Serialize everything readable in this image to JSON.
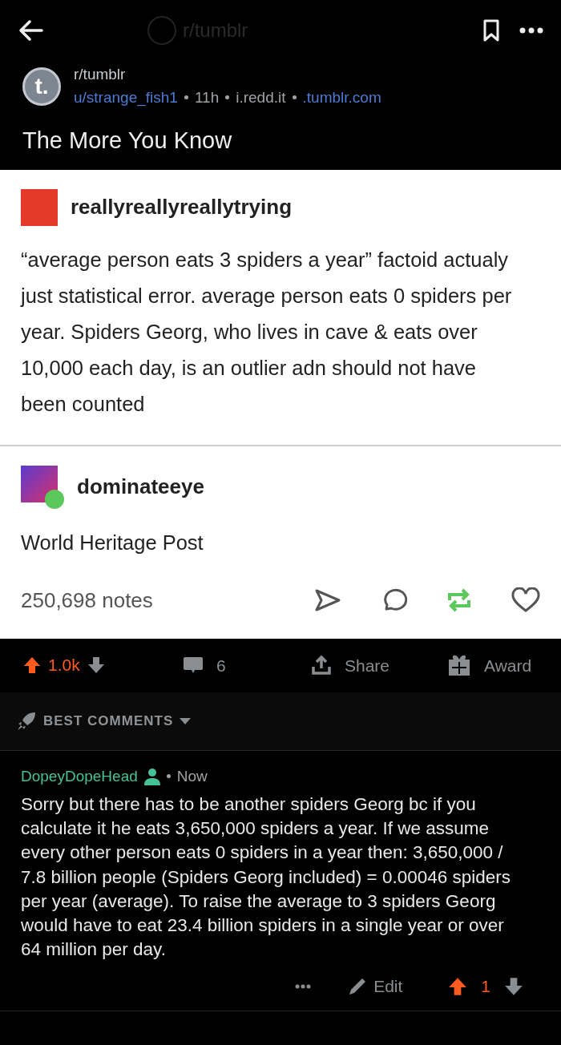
{
  "top_bar": {
    "title": "r/tumblr"
  },
  "post": {
    "avatar_text": "t.",
    "subreddit": "r/tumblr",
    "author": "u/strange_fish1",
    "age": "11h",
    "domain": "i.redd.it",
    "link_domain": ".tumblr.com",
    "title": "The More You Know"
  },
  "embed": {
    "posts": [
      {
        "username": "reallyreallyreallytrying",
        "reblog": false,
        "text": "“average person eats 3 spiders a year” factoid actualy just statistical error. average person eats 0 spiders per year. Spiders Georg, who lives in cave & eats over 10,000 each day, is an outlier adn should not have been counted"
      },
      {
        "username": "dominateeye",
        "reblog": true,
        "text": "World Heritage Post"
      }
    ],
    "notes": "250,698 notes",
    "reblogged": true,
    "liked": false
  },
  "actions": {
    "score": "1.0k",
    "upvoted": true,
    "comments": "6",
    "share": "Share",
    "award": "Award"
  },
  "sort": {
    "label": "BEST COMMENTS"
  },
  "comments": [
    {
      "author": "DopeyDopeHead",
      "time": "Now",
      "text": "Sorry but there has to be another spiders Georg bc if you calculate it he eats 3,650,000 spiders a year. If we assume every other person eats 0 spiders in a year then: 3,650,000 / 7.8 billion people (Spiders Georg included) = 0.00046 spiders per year (average). To raise the average to 3 spiders Georg would have to eat 23.4 billion spiders in a single year or over 64 million per day.",
      "edit": "Edit",
      "score": "1",
      "upvoted": true
    }
  ]
}
